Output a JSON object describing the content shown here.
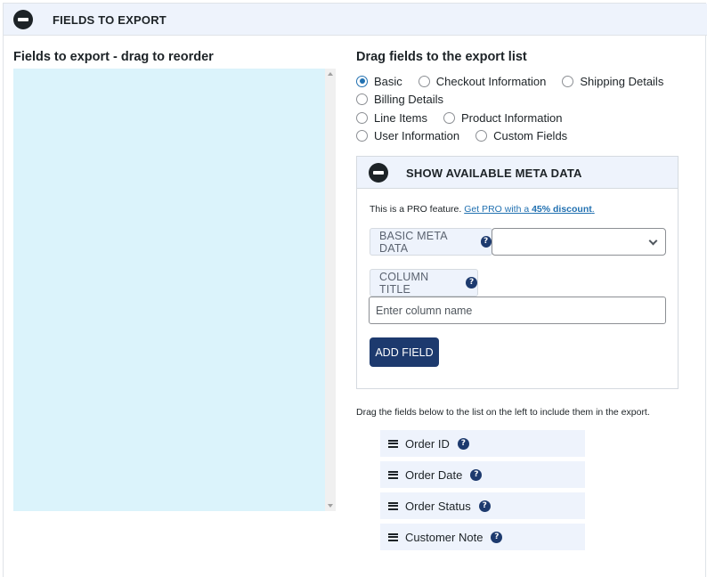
{
  "header": {
    "title": "FIELDS TO EXPORT",
    "icon": "minus-circle-icon"
  },
  "left": {
    "heading": "Fields to export - drag to reorder"
  },
  "right": {
    "heading": "Drag fields to the export list",
    "field_groups": [
      [
        {
          "label": "Basic",
          "checked": true
        },
        {
          "label": "Checkout Information",
          "checked": false
        },
        {
          "label": "Shipping Details",
          "checked": false
        }
      ],
      [
        {
          "label": "Billing Details",
          "checked": false
        }
      ],
      [
        {
          "label": "Line Items",
          "checked": false
        },
        {
          "label": "Product Information",
          "checked": false
        }
      ],
      [
        {
          "label": "User Information",
          "checked": false
        },
        {
          "label": "Custom Fields",
          "checked": false
        }
      ]
    ]
  },
  "meta": {
    "title": "SHOW AVAILABLE META DATA",
    "pro_text": "This is a PRO feature.",
    "pro_link_prefix": "Get PRO with a ",
    "pro_link_bold": "45% discount",
    "pro_suffix": ".",
    "basic_label": "BASIC META DATA",
    "basic_selected": "",
    "column_label": "COLUMN TITLE",
    "column_placeholder": "Enter column name",
    "add_button": "ADD FIELD"
  },
  "drag_note": "Drag the fields below to the list on the left to include them in the export.",
  "fields": [
    {
      "label": "Order ID"
    },
    {
      "label": "Order Date"
    },
    {
      "label": "Order Status"
    },
    {
      "label": "Customer Note"
    }
  ],
  "colors": {
    "accent": "#1d3a6e",
    "drop_zone": "#dbf3fb",
    "header_bg": "#eef3fc"
  }
}
